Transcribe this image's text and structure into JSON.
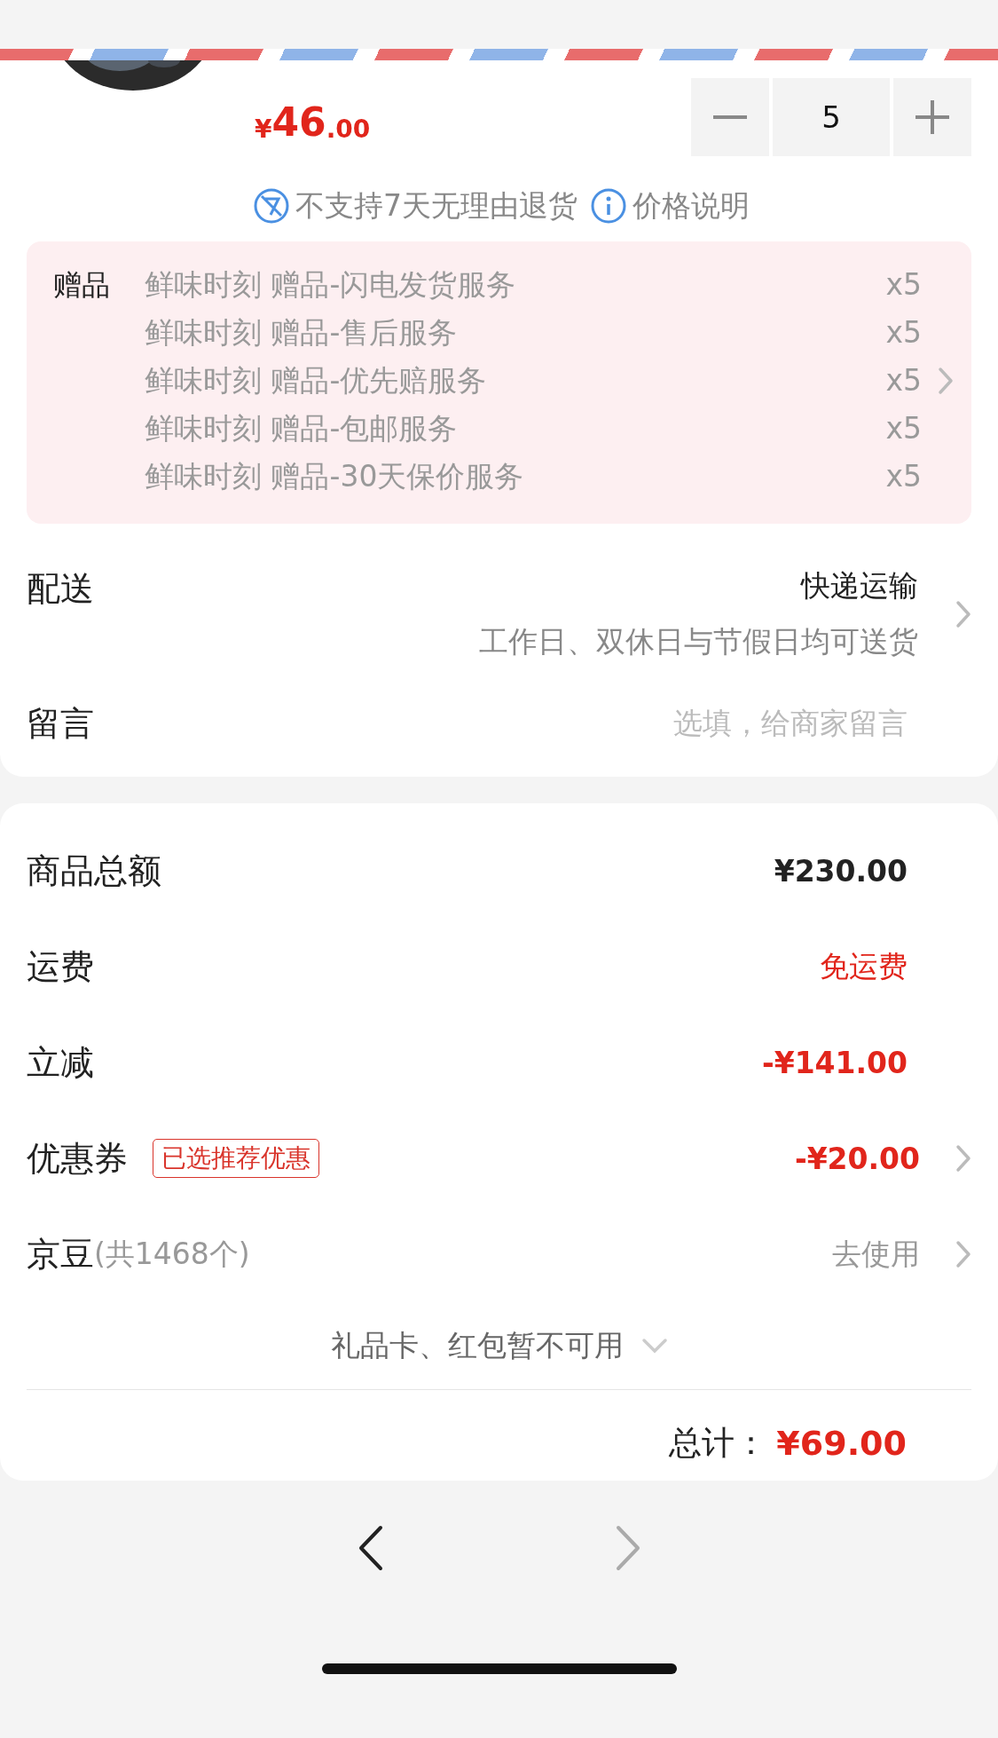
{
  "product": {
    "price": {
      "symbol": "¥",
      "integer": "46",
      "decimal": ".00"
    },
    "quantity": "5"
  },
  "notices": [
    {
      "kind": "no-return",
      "text": "不支持7天无理由退货"
    },
    {
      "kind": "info",
      "text": "价格说明"
    }
  ],
  "gifts": {
    "label": "赠品",
    "items": [
      {
        "name": "鲜味时刻 赠品-闪电发货服务",
        "qty": "x5"
      },
      {
        "name": "鲜味时刻 赠品-售后服务",
        "qty": "x5"
      },
      {
        "name": "鲜味时刻 赠品-优先赔服务",
        "qty": "x5"
      },
      {
        "name": "鲜味时刻 赠品-包邮服务",
        "qty": "x5"
      },
      {
        "name": "鲜味时刻 赠品-30天保价服务",
        "qty": "x5"
      }
    ]
  },
  "delivery": {
    "label": "配送",
    "method": "快递运输",
    "note": "工作日、双休日与节假日均可送货"
  },
  "message": {
    "label": "留言",
    "placeholder": "选填，给商家留言"
  },
  "summary": [
    {
      "kind": "amount",
      "label": "商品总额",
      "value": "¥230.00"
    },
    {
      "kind": "free",
      "label": "运费",
      "value": "免运费"
    },
    {
      "kind": "discount",
      "label": "立减",
      "value": "-¥141.00"
    },
    {
      "kind": "coupon",
      "label": "优惠券",
      "badge": "已选推荐优惠",
      "value": "-¥20.00"
    },
    {
      "kind": "beans",
      "label": "京豆",
      "note": "(共1468个)",
      "value": "去使用"
    }
  ],
  "unavailable": "礼品卡、红包暂不可用",
  "total": {
    "label": "总计：",
    "value": "¥69.00"
  },
  "nav": {
    "back": {
      "disabled": false
    },
    "forward": {
      "disabled": true
    }
  }
}
